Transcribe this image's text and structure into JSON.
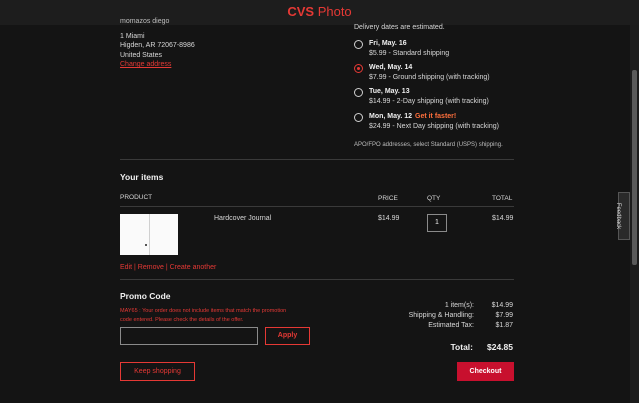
{
  "header": {
    "brand_cvs": "CVS",
    "brand_photo": "Photo"
  },
  "address": {
    "name": "momazos diego",
    "street": "1 Miami",
    "city_line": "Higden, AR 72067-8986",
    "country": "United States",
    "change_label": "Change address"
  },
  "delivery": {
    "note": "Delivery dates are estimated.",
    "options": [
      {
        "date": "Fri, May. 16",
        "desc": "$5.99 - Standard shipping",
        "selected": false,
        "badge": ""
      },
      {
        "date": "Wed, May. 14",
        "desc": "$7.99 - Ground shipping (with tracking)",
        "selected": true,
        "badge": ""
      },
      {
        "date": "Tue, May. 13",
        "desc": "$14.99 - 2-Day shipping (with tracking)",
        "selected": false,
        "badge": ""
      },
      {
        "date": "Mon, May. 12",
        "desc": "$24.99 - Next Day shipping (with tracking)",
        "selected": false,
        "badge": "Get it faster!"
      }
    ],
    "apo_note": "APO/FPO addresses, select Standard (USPS) shipping."
  },
  "items": {
    "title": "Your items",
    "headers": {
      "product": "PRODUCT",
      "price": "PRICE",
      "qty": "QTY",
      "total": "TOTAL"
    },
    "rows": [
      {
        "name": "Hardcover Journal",
        "price": "$14.99",
        "qty": "1",
        "total": "$14.99"
      }
    ],
    "actions": {
      "edit": "Edit",
      "sep": "|",
      "remove": "Remove",
      "create": "Create another"
    }
  },
  "promo": {
    "title": "Promo Code",
    "error_line1": "MAY65 : Your order does not include items that match the promotion",
    "error_line2": "code entered. Please check the details of the offer.",
    "input_value": "",
    "apply_label": "Apply"
  },
  "summary": {
    "items_label": "1 item(s):",
    "items_value": "$14.99",
    "shipping_label": "Shipping & Handling:",
    "shipping_value": "$7.99",
    "tax_label": "Estimated Tax:",
    "tax_value": "$1.87",
    "total_label": "Total:",
    "total_value": "$24.85"
  },
  "buttons": {
    "keep_shopping": "Keep shopping",
    "checkout": "Checkout"
  },
  "feedback_label": "Feedback",
  "colors": {
    "accent": "#e53935",
    "checkout_bg": "#c8102e",
    "background": "#141414"
  }
}
